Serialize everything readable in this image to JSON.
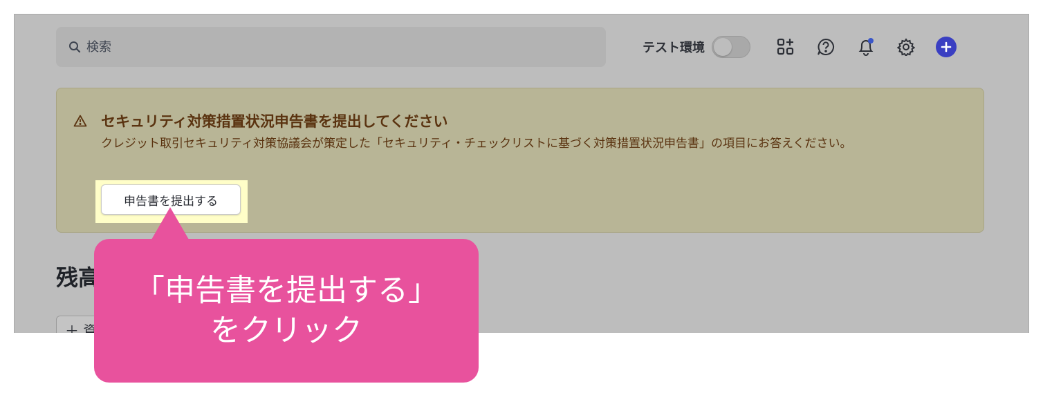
{
  "search": {
    "placeholder": "検索"
  },
  "toolbar": {
    "env_label": "テスト環境"
  },
  "banner": {
    "title": "セキュリティ対策措置状況申告書を提出してください",
    "description": "クレジット取引セキュリティ対策協議会が策定した「セキュリティ・チェックリストに基づく対策措置状況申告書」の項目にお答えください。",
    "button_label": "申告書を提出する"
  },
  "main": {
    "section_title": "残高",
    "add_button_label": "＋ 資"
  },
  "callout": {
    "line1": "「申告書を提出する」",
    "line2": "をクリック"
  },
  "colors": {
    "callout": "#e8529d",
    "banner_text": "#5a3310",
    "accent": "#3a3fc2"
  },
  "icons": [
    "search-icon",
    "apps-grid-icon",
    "help-icon",
    "bell-icon",
    "gear-icon",
    "plus-icon",
    "warning-icon"
  ]
}
